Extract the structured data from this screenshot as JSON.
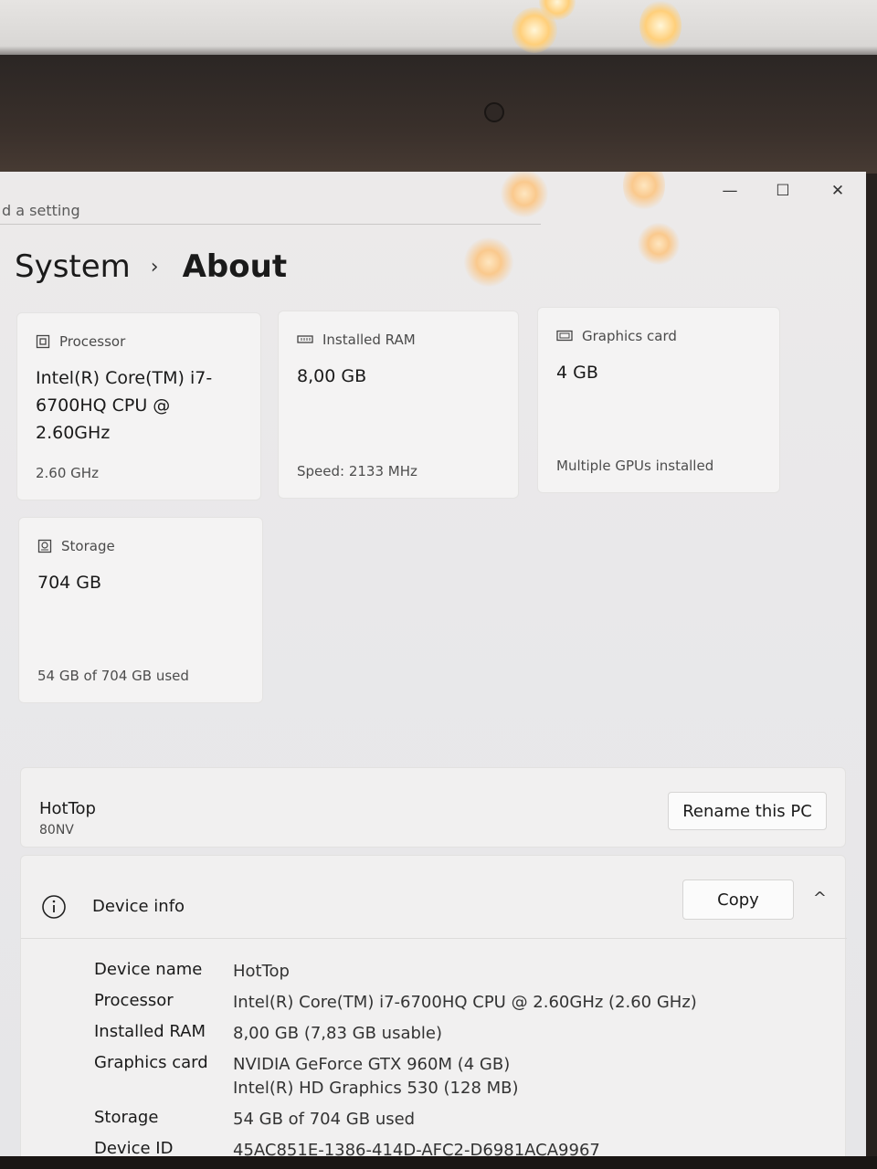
{
  "search": {
    "placeholder": "d a setting"
  },
  "window": {
    "minimize_glyph": "—",
    "maximize_glyph": "☐",
    "close_glyph": "✕"
  },
  "breadcrumb": {
    "parent": "System",
    "separator": "›",
    "current": "About"
  },
  "cards": {
    "processor": {
      "label": "Processor",
      "value": "Intel(R) Core(TM) i7-6700HQ CPU @ 2.60GHz",
      "sub": "2.60 GHz",
      "icon": "processor-icon"
    },
    "ram": {
      "label": "Installed RAM",
      "value": "8,00 GB",
      "sub": "Speed: 2133 MHz",
      "icon": "ram-icon"
    },
    "gpu": {
      "label": "Graphics card",
      "value": "4 GB",
      "sub": "Multiple GPUs installed",
      "icon": "gpu-icon"
    },
    "storage": {
      "label": "Storage",
      "value": "704 GB",
      "sub": "54 GB of 704 GB used",
      "icon": "storage-icon"
    }
  },
  "pc": {
    "name": "HotTop",
    "model": "80NV",
    "rename_label": "Rename this PC"
  },
  "device_info": {
    "title": "Device info",
    "copy_label": "Copy",
    "expand_glyph": "^",
    "specs": [
      {
        "key": "Device name",
        "value": "HotTop"
      },
      {
        "key": "Processor",
        "value": "Intel(R) Core(TM) i7-6700HQ CPU @ 2.60GHz (2.60 GHz)"
      },
      {
        "key": "Installed RAM",
        "value": "8,00 GB (7,83 GB usable)"
      },
      {
        "key": "Graphics card",
        "value": "NVIDIA GeForce GTX 960M (4 GB)",
        "value2": "Intel(R) HD Graphics 530 (128 MB)"
      },
      {
        "key": "Storage",
        "value": "54 GB of 704 GB used"
      },
      {
        "key": "Device ID",
        "value": "45AC851E-1386-414D-AFC2-D6981ACA9967"
      }
    ]
  }
}
